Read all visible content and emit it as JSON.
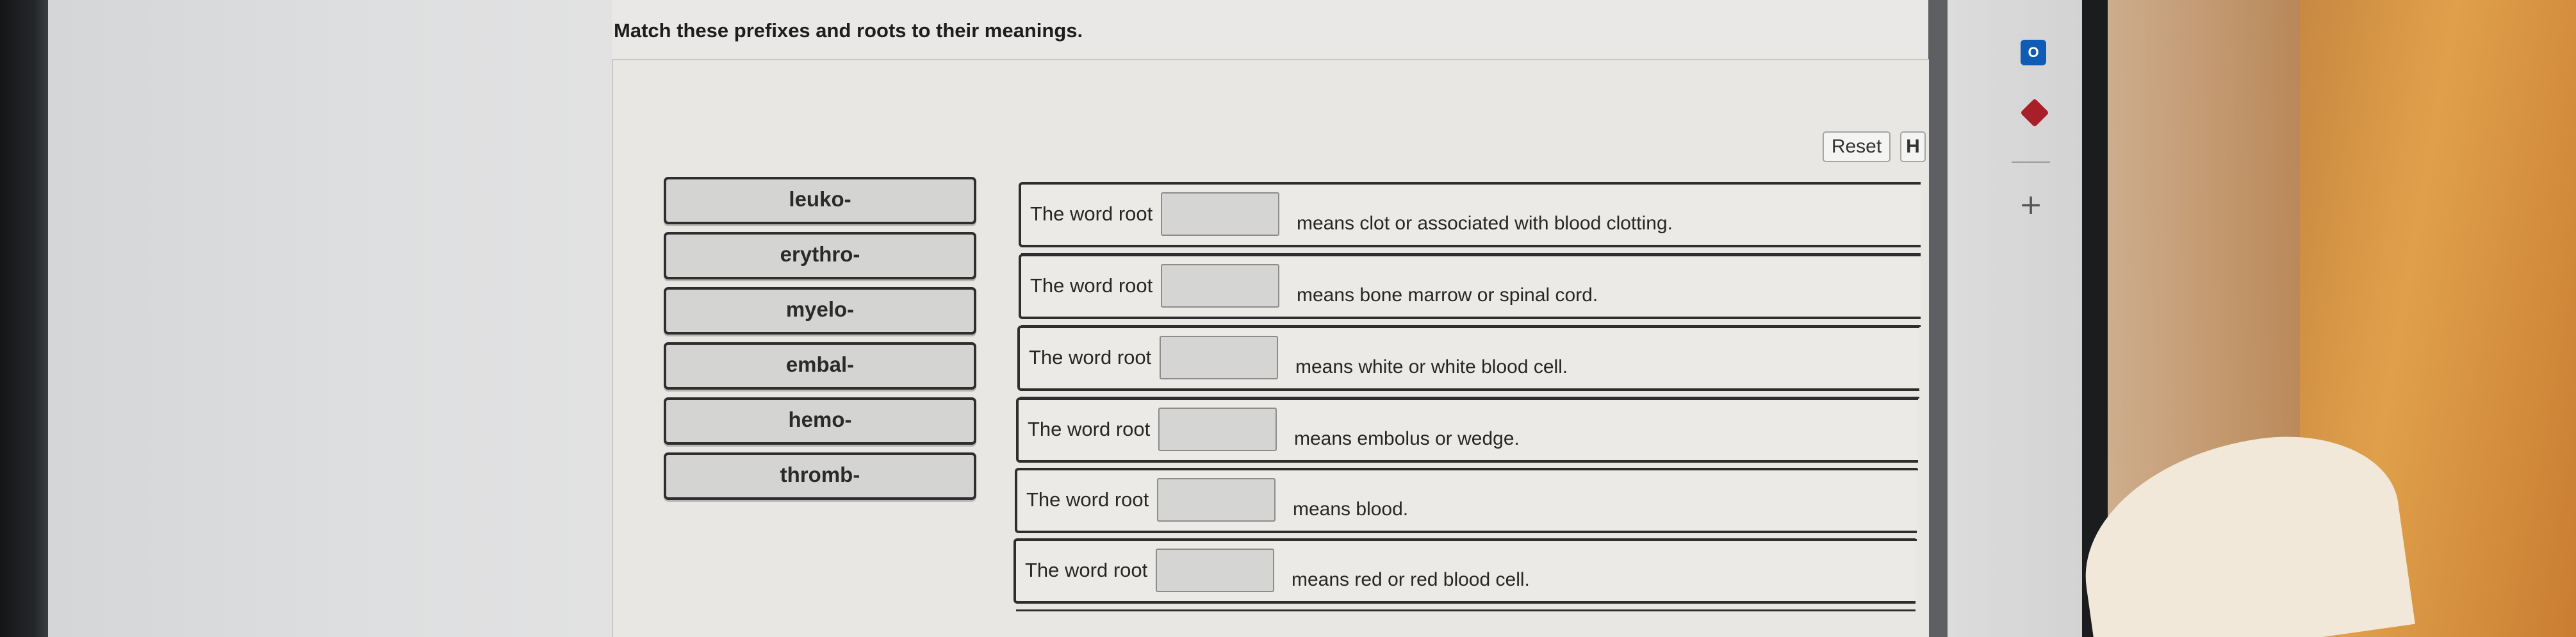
{
  "instructions": "Match these prefixes and roots to their meanings.",
  "controls": {
    "reset_label": "Reset",
    "help_label": "H"
  },
  "prefixes": [
    "leuko-",
    "erythro-",
    "myelo-",
    "embal-",
    "hemo-",
    "thromb-"
  ],
  "rows": [
    {
      "label": "The word root",
      "meaning": "means clot or associated with blood clotting."
    },
    {
      "label": "The word root",
      "meaning": "means bone marrow or spinal cord."
    },
    {
      "label": "The word root",
      "meaning": "means white or white blood cell."
    },
    {
      "label": "The word root",
      "meaning": "means embolus or wedge."
    },
    {
      "label": "The word root",
      "meaning": "means blood."
    },
    {
      "label": "The word root",
      "meaning": "means red or red blood cell."
    }
  ],
  "side_icons": {
    "outlook_glyph": "O",
    "add_glyph": "+"
  },
  "colors": {
    "chip_bg": "#d4d4d3",
    "border": "#2e2e2e",
    "page_bg": "#e8e7e4"
  }
}
